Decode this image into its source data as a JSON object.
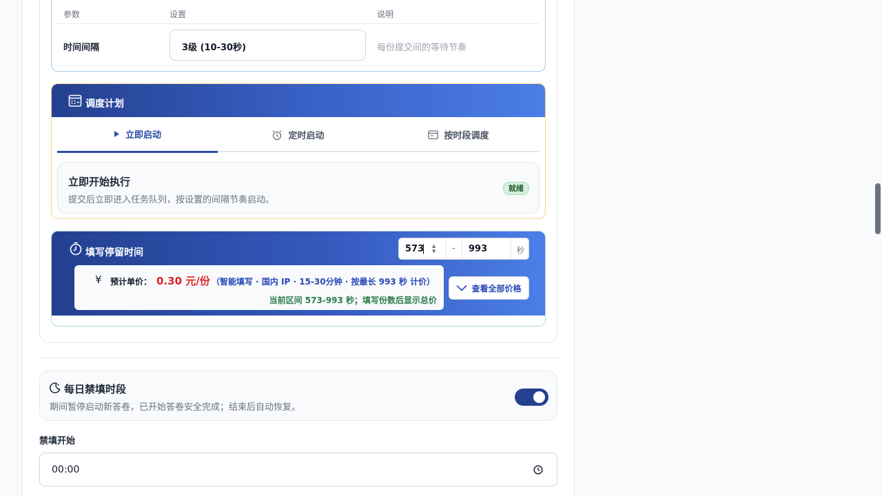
{
  "param_table": {
    "headers": [
      "参数",
      "设置",
      "说明"
    ],
    "row": {
      "name": "时间间隔",
      "value": "3级 (10-30秒)",
      "desc": "每份提交间的等待节奏"
    }
  },
  "schedule": {
    "title": "调度计划",
    "tabs": [
      {
        "label": "立即启动",
        "icon": "play-icon",
        "active": true
      },
      {
        "label": "定时启动",
        "icon": "alarm-clock-icon",
        "active": false
      },
      {
        "label": "按时段调度",
        "icon": "calendar-icon",
        "active": false
      }
    ],
    "panel": {
      "title": "立即开始执行",
      "desc": "提交后立即进入任务队列，按设置的间隔节奏启动。",
      "badge": "就绪"
    }
  },
  "dwell": {
    "title": "填写停留时间",
    "min": "573",
    "separator": "-",
    "max": "993",
    "unit": "秒",
    "price_icon": "¥",
    "price_label": "预计单价：",
    "price_value": "0.30 元/份",
    "price_note": "（智能填写 · 国内 IP · 15-30分钟 · 按最长 993 秒 计价）",
    "range_note": "当前区间 573-993 秒；填写份数后显示总价",
    "view_all": "查看全部价格"
  },
  "quiet_hours": {
    "title": "每日禁填时段",
    "desc": "期间暂停启动新答卷，已开始答卷安全完成；结束后自动恢复。",
    "enabled": true
  },
  "quiet_start": {
    "label": "禁填开始",
    "value": "00:00"
  },
  "colors": {
    "accent": "#2b4ea8",
    "price": "#dc2626",
    "range": "#2a7a4a"
  }
}
